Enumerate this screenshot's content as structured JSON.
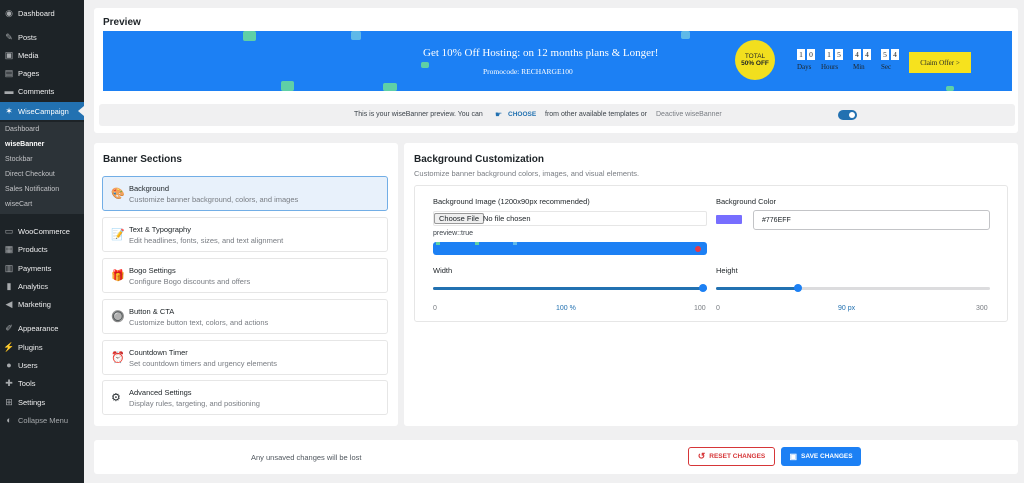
{
  "sidebar": {
    "items": [
      {
        "label": "Dashboard",
        "icon": "dashboard-icon"
      },
      {
        "label": "Posts",
        "icon": "pin-icon"
      },
      {
        "label": "Media",
        "icon": "media-icon"
      },
      {
        "label": "Pages",
        "icon": "pages-icon"
      },
      {
        "label": "Comments",
        "icon": "comments-icon"
      },
      {
        "label": "WiseCampaign",
        "icon": "campaign-icon"
      },
      {
        "label": "WooCommerce",
        "icon": "woocommerce-icon"
      },
      {
        "label": "Products",
        "icon": "products-icon"
      },
      {
        "label": "Payments",
        "icon": "payments-icon"
      },
      {
        "label": "Analytics",
        "icon": "analytics-icon"
      },
      {
        "label": "Marketing",
        "icon": "marketing-icon"
      },
      {
        "label": "Appearance",
        "icon": "appearance-icon"
      },
      {
        "label": "Plugins",
        "icon": "plugins-icon"
      },
      {
        "label": "Users",
        "icon": "users-icon"
      },
      {
        "label": "Tools",
        "icon": "tools-icon"
      },
      {
        "label": "Settings",
        "icon": "settings-icon"
      },
      {
        "label": "Collapse Menu",
        "icon": "collapse-icon"
      }
    ],
    "submenu": [
      "Dashboard",
      "wiseBanner",
      "Stockbar",
      "Direct Checkout",
      "Sales Notification",
      "wiseCart"
    ]
  },
  "preview": {
    "title": "Preview",
    "banner": {
      "headline": "Get 10% Off Hosting: on 12 months plans & Longer!",
      "promo": "Promocode: RECHARGE100",
      "badge_top": "TOTAL",
      "badge_bottom": "50% OFF",
      "digits": [
        "1",
        "0",
        "1",
        "5",
        "4",
        "4",
        "5",
        "4"
      ],
      "labels": [
        "Days",
        "Hours",
        "Min",
        "Sec"
      ],
      "cta": "Claim Offer >"
    },
    "bar": {
      "text_before": "This is your wiseBanner preview. You can",
      "choose": "CHOOSE",
      "text_after": "from other available templates or",
      "deactive": "Deactive wiseBanner"
    }
  },
  "sections": {
    "title": "Banner Sections",
    "items": [
      {
        "title": "Background",
        "desc": "Customize banner background, colors, and images",
        "icon": "palette-icon"
      },
      {
        "title": "Text & Typography",
        "desc": "Edit headlines, fonts, sizes, and text alignment",
        "icon": "text-edit-icon"
      },
      {
        "title": "Bogo Settings",
        "desc": "Configure Bogo discounts and offers",
        "icon": "gift-icon"
      },
      {
        "title": "Button & CTA",
        "desc": "Customize button text, colors, and actions",
        "icon": "button-icon"
      },
      {
        "title": "Countdown Timer",
        "desc": "Set countdown timers and urgency elements",
        "icon": "alarm-clock-icon"
      },
      {
        "title": "Advanced Settings",
        "desc": "Display rules, targeting, and positioning",
        "icon": "gear-icon"
      }
    ]
  },
  "customization": {
    "title": "Background Customization",
    "subtitle": "Customize banner background colors, images, and visual elements.",
    "image_label": "Background Image (1200x90px recommended)",
    "choose_file": "Choose File",
    "no_file": "No file chosen",
    "preview_note": "preview::true",
    "color_label": "Background Color",
    "color_value": "#776EFF",
    "width_label": "Width",
    "width_min": "0",
    "width_value": "100 %",
    "width_max": "100",
    "width_fraction": 1.0,
    "height_label": "Height",
    "height_min": "0",
    "height_value": "90 px",
    "height_max": "300",
    "height_fraction": 0.3
  },
  "footer": {
    "unsaved": "Any unsaved changes will be lost",
    "reset": "RESET CHANGES",
    "save": "SAVE CHANGES"
  },
  "colors": {
    "accent": "#2271b1",
    "banner_bg": "#1c80f4",
    "reset": "#d63638",
    "swatch": "#776EFF"
  }
}
